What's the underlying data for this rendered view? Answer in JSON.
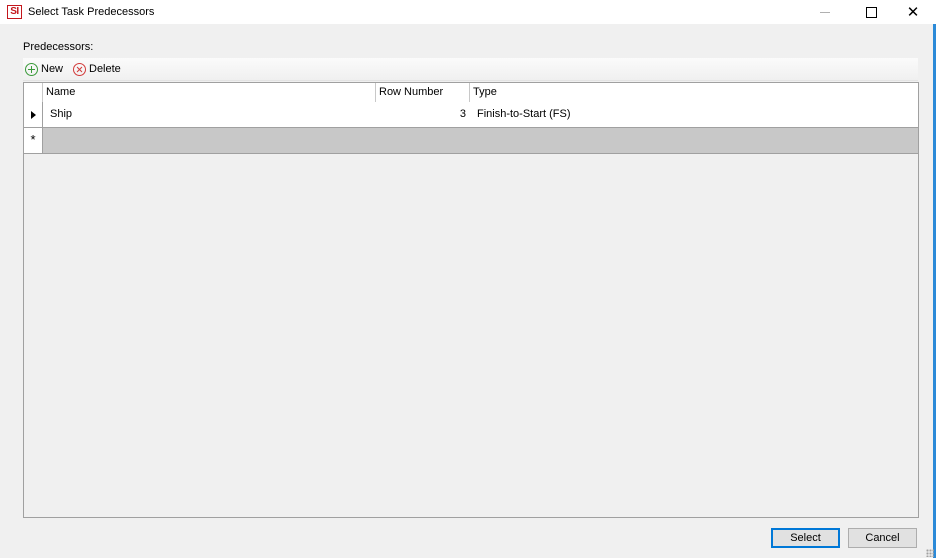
{
  "window": {
    "icon_text": "SI",
    "title": "Select Task Predecessors",
    "close_glyph": "✕"
  },
  "predecessors": {
    "label": "Predecessors:",
    "toolbar": {
      "new_label": "New",
      "delete_label": "Delete"
    },
    "columns": [
      "Name",
      "Row Number",
      "Type"
    ],
    "rows": [
      {
        "name": "Ship",
        "row_number": "3",
        "type": "Finish-to-Start (FS)"
      }
    ],
    "new_row_glyph": "*"
  },
  "buttons": {
    "select_label": "Select",
    "cancel_label": "Cancel"
  },
  "colors": {
    "accent": "#0078d7",
    "frame": "#2b8ad8",
    "brand": "#c4161c"
  }
}
